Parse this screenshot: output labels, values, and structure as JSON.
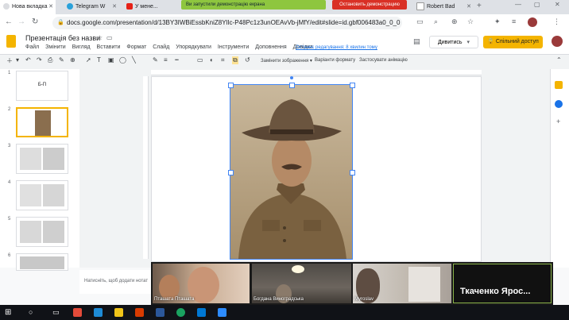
{
  "browser": {
    "tabs": [
      {
        "label": "Нова вкладка"
      },
      {
        "label": "Telegram W"
      },
      {
        "label": "У мене..."
      },
      {
        "label": "Robert Bad"
      }
    ],
    "share_banner": "Ви запустили демонстрацію екрана",
    "stop_share": "Остановить демонстрацию",
    "url": "docs.google.com/presentation/d/13BY3IWBiEssbKniZ8YlIc-P48Pc1z3unOEAvVb-jMfY/edit#slide=id.gbf006483a0_0_0"
  },
  "app": {
    "title": "Презентація без назви",
    "menu": [
      "Файл",
      "Змінити",
      "Вигляд",
      "Вставити",
      "Формат",
      "Слайд",
      "Упорядкувати",
      "Інструменти",
      "Доповнення",
      "Довідка"
    ],
    "last_edit": "Останнє редагування: 8 хвилин тому",
    "present_label": "Дивитись",
    "share_label": "Спільний доступ",
    "toolbar": {
      "replace_image": "Замінити зображення ▾",
      "format_options": "Варіанти формату",
      "animate": "Застосувати анімацію"
    }
  },
  "filmstrip": {
    "slides": [
      {
        "num": "1",
        "text": "Б-П"
      },
      {
        "num": "2",
        "text": ""
      },
      {
        "num": "3",
        "text": ""
      },
      {
        "num": "4",
        "text": ""
      },
      {
        "num": "5",
        "text": ""
      },
      {
        "num": "6",
        "text": ""
      }
    ]
  },
  "notes_placeholder": "Натисніть, щоб додати нотат",
  "video": {
    "participants": [
      {
        "name": "Пташата Пташата"
      },
      {
        "name": "Богдана Виноградська"
      },
      {
        "name": "Myroslav"
      },
      {
        "name": "Ткаченко Ярос..."
      }
    ]
  },
  "colors": {
    "accent": "#f4b400",
    "selection": "#4285f4",
    "share_banner": "#8ec63f",
    "stop": "#d93025"
  }
}
